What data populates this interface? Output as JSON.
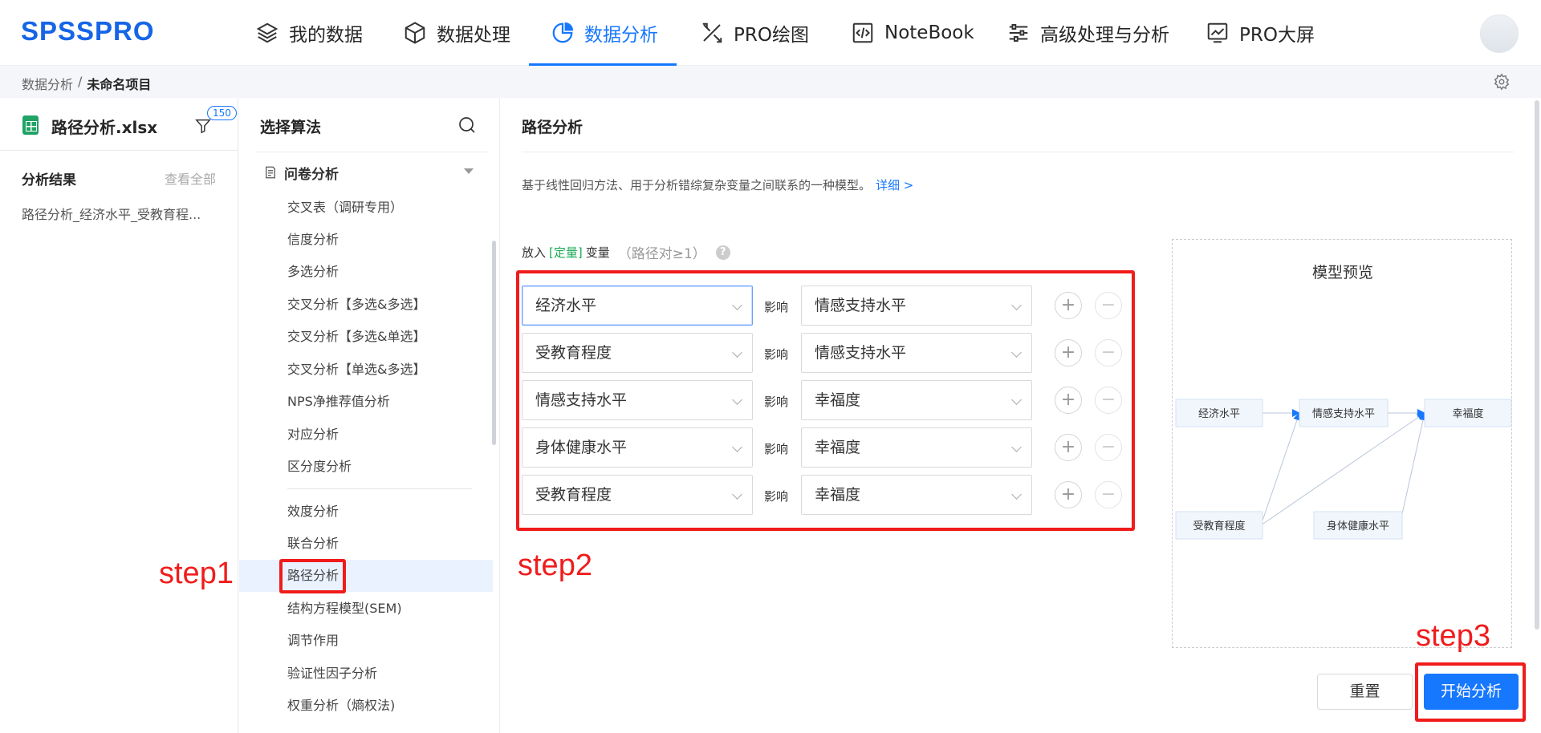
{
  "app": {
    "logo": "SPSSPRO"
  },
  "nav": {
    "items": [
      {
        "label": "我的数据",
        "icon": "layers-icon"
      },
      {
        "label": "数据处理",
        "icon": "cube-icon"
      },
      {
        "label": "数据分析",
        "icon": "pie-chart-icon",
        "active": true
      },
      {
        "label": "PRO绘图",
        "icon": "drawing-tools-icon"
      },
      {
        "label": "NoteBook",
        "icon": "code-icon"
      },
      {
        "label": "高级处理与分析",
        "icon": "sliders-icon"
      },
      {
        "label": "PRO大屏",
        "icon": "dashboard-icon"
      }
    ],
    "accent": "#1677ff"
  },
  "breadcrumb": {
    "parent": "数据分析",
    "separator": "/",
    "current": "未命名项目"
  },
  "file": {
    "name": "路径分析.xlsx",
    "filter_count": "150"
  },
  "results": {
    "title": "分析结果",
    "view_all": "查看全部",
    "item": "路径分析_经济水平_受教育程..."
  },
  "algorithms": {
    "title": "选择算法",
    "group": "问卷分析",
    "items": [
      "交叉表（调研专用）",
      "信度分析",
      "多选分析",
      "交叉分析【多选&多选】",
      "交叉分析【多选&单选】",
      "交叉分析【单选&多选】",
      "NPS净推荐值分析",
      "对应分析",
      "区分度分析",
      "效度分析",
      "联合分析",
      "路径分析",
      "结构方程模型(SEM)",
      "调节作用",
      "验证性因子分析",
      "权重分析（熵权法)"
    ],
    "selected": "路径分析"
  },
  "main": {
    "title": "路径分析",
    "description": "基于线性回归方法、用于分析错综复杂变量之间联系的一种模型。",
    "detail_link": "详细 >",
    "var_prefix": "放入",
    "var_type": "[定量]",
    "var_suffix": "变量",
    "var_hint": "（路径对≥1）",
    "help": "?",
    "affect_label": "影响",
    "plus": "+",
    "minus": "−",
    "paths": [
      {
        "from": "经济水平",
        "to": "情感支持水平"
      },
      {
        "from": "受教育程度",
        "to": "情感支持水平"
      },
      {
        "from": "情感支持水平",
        "to": "幸福度"
      },
      {
        "from": "身体健康水平",
        "to": "幸福度"
      },
      {
        "from": "受教育程度",
        "to": "幸福度"
      }
    ]
  },
  "preview": {
    "title": "模型预览",
    "nodes": [
      "经济水平",
      "情感支持水平",
      "幸福度",
      "受教育程度",
      "身体健康水平"
    ]
  },
  "buttons": {
    "reset": "重置",
    "start": "开始分析"
  },
  "annotations": {
    "step1": "step1",
    "step2": "step2",
    "step3": "step3",
    "color": "#f01c1c"
  }
}
